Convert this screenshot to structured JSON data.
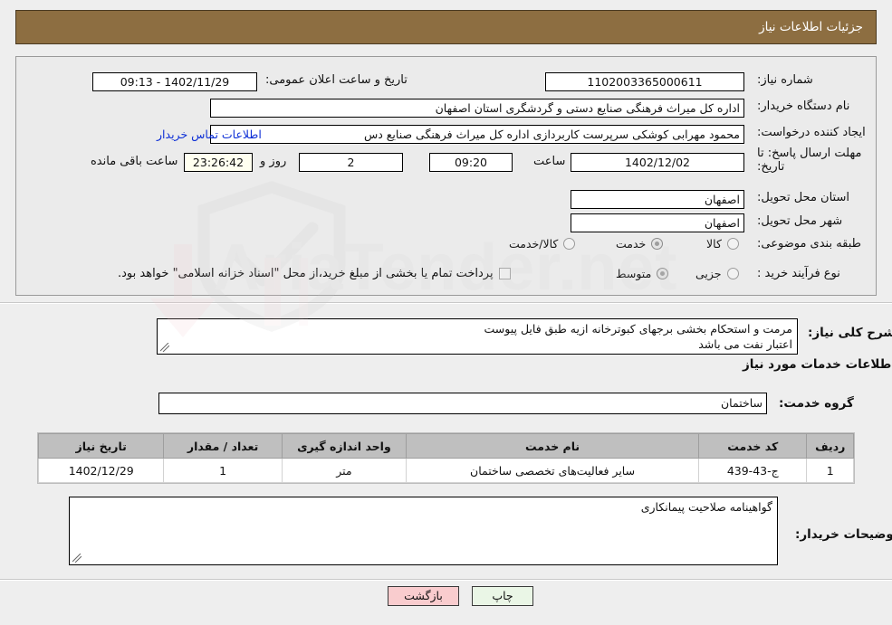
{
  "header": {
    "title": "جزئیات اطلاعات نیاز"
  },
  "form": {
    "need_number_label": "شماره نیاز:",
    "need_number_value": "1102003365000611",
    "announce_datetime_label": "تاریخ و ساعت اعلان عمومی:",
    "announce_datetime_value": "1402/11/29 - 09:13",
    "buyer_org_label": "نام دستگاه خریدار:",
    "buyer_org_value": "اداره کل میراث فرهنگی  صنایع دستی و گردشگری استان اصفهان",
    "creator_label": "ایجاد کننده درخواست:",
    "creator_value": "محمود مهرابی کوشکی سرپرست کاربردازی اداره کل میراث فرهنگی  صنایع دس",
    "contact_link": "اطلاعات تماس خریدار",
    "deadline_label_line1": "مهلت ارسال پاسخ: تا",
    "deadline_label_line2": "تاریخ:",
    "deadline_date": "1402/12/02",
    "deadline_hour_label": "ساعت",
    "deadline_hour": "09:20",
    "remaining_days": "2",
    "remaining_days_label": "روز و",
    "remaining_time": "23:26:42",
    "remaining_time_label": "ساعت باقی مانده",
    "province_label": "استان محل تحویل:",
    "province_value": "اصفهان",
    "city_label": "شهر محل تحویل:",
    "city_value": "اصفهان",
    "category_label": "طبقه بندی موضوعی:",
    "category_options": [
      "کالا",
      "خدمت",
      "کالا/خدمت"
    ],
    "category_selected_index": 1,
    "process_label": "نوع فرآیند خرید :",
    "process_options": [
      "جزیی",
      "متوسط"
    ],
    "process_selected_index": 1,
    "treasury_checkbox_text": "پرداخت تمام یا بخشی از مبلغ خرید،از محل \"اسناد خزانه اسلامی\" خواهد بود.",
    "treasury_checked": false
  },
  "description": {
    "label": "شرح کلی نیاز:",
    "line1": "مرمت و استحکام بخشی برجهای کبوترخانه ازیه طبق فایل پیوست",
    "line2": "اعتبار نفت می باشد"
  },
  "services": {
    "section_title": "اطلاعات خدمات مورد نیاز",
    "group_label": "گروه خدمت:",
    "group_value": "ساختمان",
    "columns": [
      "ردیف",
      "کد خدمت",
      "نام خدمت",
      "واحد اندازه گیری",
      "تعداد / مقدار",
      "تاریخ نیاز"
    ],
    "rows": [
      {
        "index": "1",
        "code": "ج-43-439",
        "name": "سایر فعالیت‌های تخصصی ساختمان",
        "unit": "متر",
        "quantity": "1",
        "need_date": "1402/12/29"
      }
    ]
  },
  "buyer_notes": {
    "label": "توضیحات خریدار:",
    "value": "گواهینامه صلاحیت پیمانکاری"
  },
  "footer": {
    "print_label": "چاپ",
    "back_label": "بازگشت"
  },
  "watermark": {
    "text": "AriaTender.net"
  }
}
